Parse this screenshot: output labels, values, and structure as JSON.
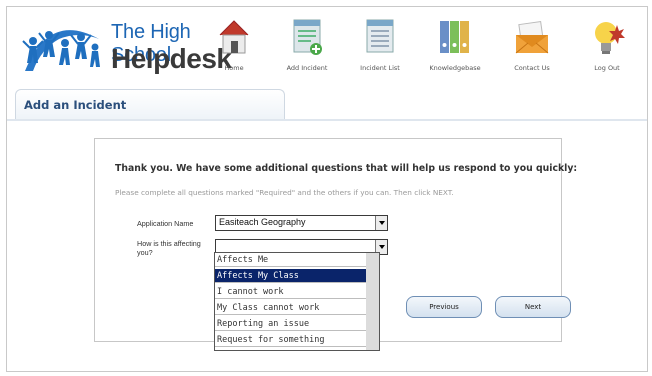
{
  "app": {
    "title_line1": "The High School",
    "title_line2": "Helpdesk"
  },
  "nav": [
    {
      "label": "Home",
      "icon": "house-icon"
    },
    {
      "label": "Add Incident",
      "icon": "add-document-icon"
    },
    {
      "label": "Incident List",
      "icon": "list-document-icon"
    },
    {
      "label": "Knowledgebase",
      "icon": "binders-icon"
    },
    {
      "label": "Contact Us",
      "icon": "envelope-icon"
    },
    {
      "label": "Log Out",
      "icon": "lightbulb-icon"
    }
  ],
  "page": {
    "tab_label": "Add an Incident"
  },
  "form": {
    "heading": "Thank you. We have some additional questions that will help us respond to you quickly:",
    "instructions": "Please complete all questions marked \"Required\" and the others if you can. Then click NEXT.",
    "fields": {
      "application_label": "Application Name",
      "application_value": "Easiteach Geography",
      "affecting_label_line1": "How is this affecting",
      "affecting_label_line2": "you?",
      "affecting_value": ""
    },
    "dropdown_options": [
      "Affects Me",
      "Affects My Class",
      "I cannot work",
      "My Class cannot work",
      "Reporting an issue",
      "Request for something"
    ],
    "selected_option": "Affects My Class",
    "buttons": {
      "previous": "Previous",
      "next": "Next"
    }
  },
  "colors": {
    "brand_blue": "#1d66b4",
    "tab_text": "#2b4f7c",
    "selection": "#0a246a"
  }
}
